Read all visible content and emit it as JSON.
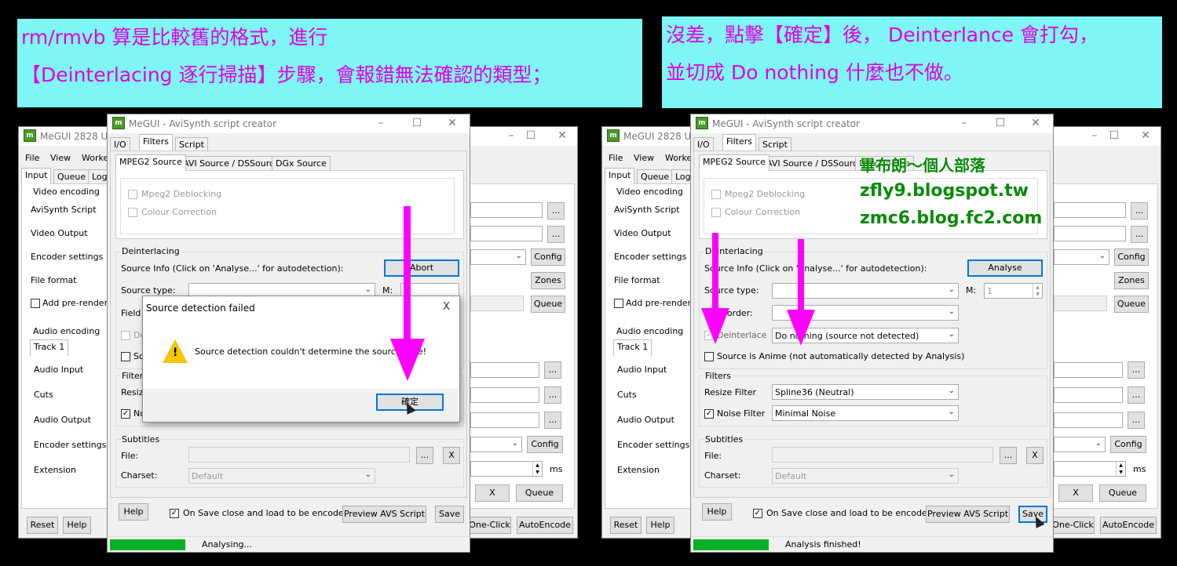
{
  "captions": {
    "left_line1": "rm/rmvb 算是比較舊的格式，進行",
    "left_line2": "【Deinterlacing 逐行掃描】步驟，會報錯無法確認的類型；",
    "right_line1": "沒差，點擊【確定】後， Deinterlance 會打勾，",
    "right_line2": "並切成 Do nothing 什麼也不做。"
  },
  "watermark": {
    "line1": "畢布朗～個人部落",
    "line2": "zfly9.blogspot.tw",
    "line3": "zmc6.blog.fc2.com"
  },
  "megui_main": {
    "title": "MeGUI 2828 U",
    "menu": [
      "File",
      "View",
      "Worke"
    ],
    "tabs": [
      "Input",
      "Queue",
      "Log"
    ],
    "video_group": "Video encoding",
    "avisynth_script": "AviSynth Script",
    "video_output": "Video Output",
    "encoder_settings": "Encoder settings",
    "file_format": "File format",
    "add_prerender": "Add pre-rendering",
    "audio_group": "Audio encoding",
    "track_tab": "Track 1",
    "audio_input": "Audio Input",
    "cuts": "Cuts",
    "audio_output": "Audio Output",
    "audio_encoder_settings": "Encoder settings",
    "extension": "Extension",
    "ellipsis": "...",
    "config": "Config",
    "zones": "Zones",
    "queue": "Queue",
    "x": "X",
    "ms": "ms",
    "reset": "Reset",
    "help": "Help",
    "oneclick": "One-Click",
    "autoencode": "AutoEncode"
  },
  "creator": {
    "title": "MeGUI - AviSynth script creator",
    "tabs": [
      "I/O",
      "Filters",
      "Script"
    ],
    "subtabs": [
      "MPEG2 Source",
      "AVI Source / DSSource",
      "DGx Source"
    ],
    "mpeg2_deblocking": "Mpeg2 Deblocking",
    "colour_correction": "Colour Correction",
    "deinterlacing_group": "Deinterlacing",
    "source_info": "Source Info (Click on 'Analyse...' for autodetection):",
    "source_type": "Source type:",
    "m_label": "M:",
    "field_order": "Field order:",
    "deinterlace": "Deinterlace",
    "anime": "Source is Anime (not automatically detected by Analysis)",
    "filters_group": "Filters",
    "resize_filter": "Resize Filter",
    "noise_filter": "Noise Filter",
    "subtitles_group": "Subtitles",
    "file": "File:",
    "charset": "Charset:",
    "charset_default": "Default",
    "help": "Help",
    "on_save": "On Save close and load to be encoded",
    "preview": "Preview AVS Script",
    "save": "Save"
  },
  "left_state": {
    "analyse_button": "Abort",
    "status": "Analysing...",
    "truncated_field": "Field",
    "truncated_de": "De",
    "truncated_so": "So",
    "truncated_resize": "Resize",
    "truncated_no": "No"
  },
  "dialog": {
    "title": "Source detection failed",
    "message": "Source detection couldn't determine the source type!",
    "ok": "確定",
    "close": "X"
  },
  "right_state": {
    "analyse_button": "Analyse",
    "status": "Analysis finished!",
    "m_value": "1",
    "deinterlace_mode": "Do nothing (source not detected)",
    "resize_value": "Spline36 (Neutral)",
    "noise_value": "Minimal Noise",
    "deinterlace_checked": "✓",
    "noise_checked": "✓",
    "onsave_checked": "✓"
  },
  "colors": {
    "caption_bg": "#7ff6f6",
    "caption_text": "#e000e0",
    "arrow": "#ff00ff",
    "progress": "#06b025",
    "watermark": "#0a8a0a"
  }
}
